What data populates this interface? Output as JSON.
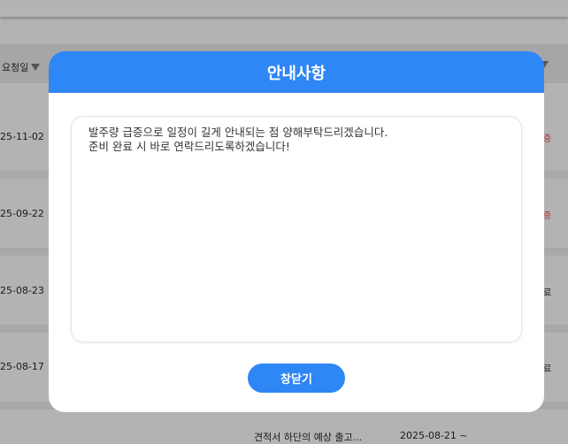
{
  "background": {
    "header_label": "요청일",
    "rows": [
      {
        "date": "25-11-02",
        "status": "중"
      },
      {
        "date": "25-09-22",
        "status": "중"
      },
      {
        "date": "25-08-23",
        "status": "료"
      },
      {
        "date": "25-08-17",
        "status": "료"
      }
    ],
    "bottom_text_left": "견적서 하단의 예상 출고...",
    "bottom_text_right": "2025-08-21 ~"
  },
  "modal": {
    "title": "안내사항",
    "message_lines": [
      "발주량 급증으로 일정이 길게 안내되는 점 양해부탁드리겠습니다.",
      "준비 완료 시 바로 연락드리도록하겠습니다!"
    ],
    "close_label": "창닫기"
  },
  "colors": {
    "accent": "#2f86f5",
    "status_red": "#b03030"
  }
}
